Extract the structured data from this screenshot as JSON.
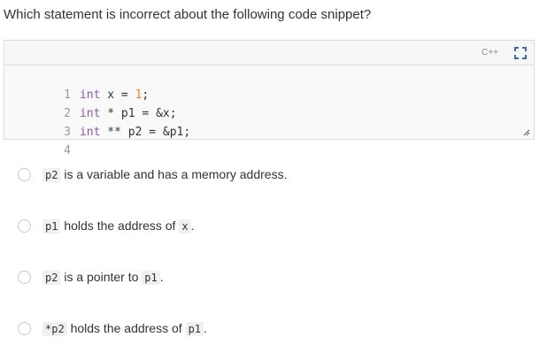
{
  "question": "Which statement is incorrect about the following code snippet?",
  "editor": {
    "language": "C++",
    "lines": [
      {
        "no": "1",
        "t1": "int",
        "t2": " x = ",
        "t3": "1",
        "t4": ";"
      },
      {
        "no": "2",
        "t1": "int",
        "t2": " * p1 = &x;",
        "t3": "",
        "t4": ""
      },
      {
        "no": "3",
        "t1": "int",
        "t2": " ** p2 = &p1;",
        "t3": "",
        "t4": ""
      },
      {
        "no": "4",
        "t1": "",
        "t2": "",
        "t3": "",
        "t4": ""
      }
    ]
  },
  "options": [
    {
      "code_pre": "p2",
      "text": " is a variable and has a memory address.",
      "code_post": "",
      "tail": ""
    },
    {
      "code_pre": "p1",
      "text": " holds the address of ",
      "code_post": "x",
      "tail": "."
    },
    {
      "code_pre": "p2",
      "text": " is a pointer to ",
      "code_post": "p1",
      "tail": "."
    },
    {
      "code_pre": "*p2",
      "text": " holds the address of ",
      "code_post": "p1",
      "tail": "."
    }
  ],
  "colors": {
    "keyword": "#8959a8",
    "number": "#f5871f",
    "line_number": "#9a9a9a"
  }
}
